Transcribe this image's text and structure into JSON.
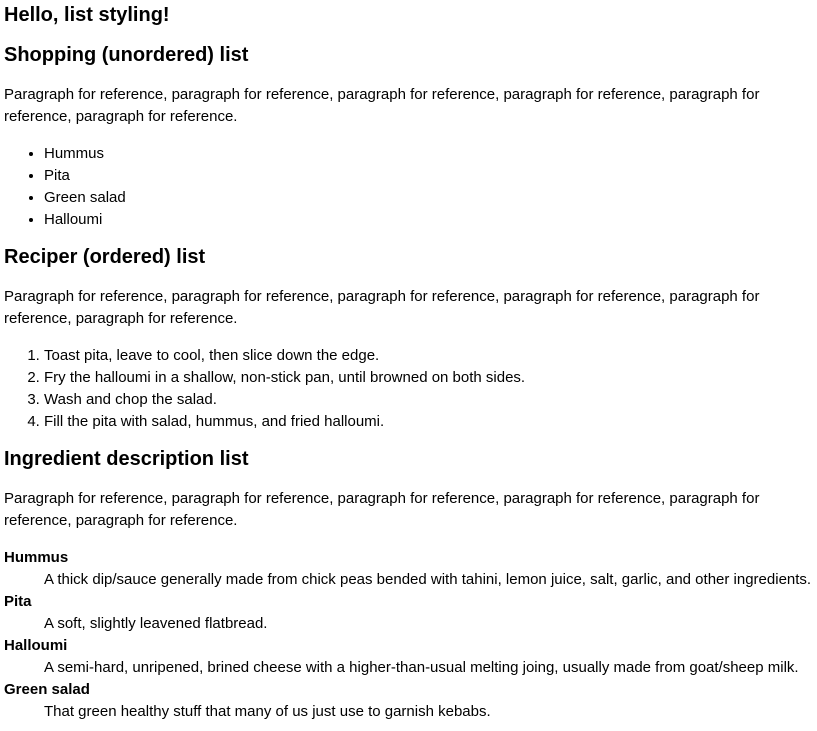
{
  "page_title": "Hello, list styling!",
  "shopping": {
    "heading": "Shopping (unordered) list",
    "paragraph": "Paragraph for reference, paragraph for reference, paragraph for reference, paragraph for reference, paragraph for reference, paragraph for reference.",
    "items": [
      "Hummus",
      "Pita",
      "Green salad",
      "Halloumi"
    ]
  },
  "recipe": {
    "heading": "Reciper (ordered) list",
    "paragraph": "Paragraph for reference, paragraph for reference, paragraph for reference, paragraph for reference, paragraph for reference, paragraph for reference.",
    "steps": [
      "Toast pita, leave to cool, then slice down the edge.",
      "Fry the halloumi in a shallow, non-stick pan, until browned on both sides.",
      "Wash and chop the salad.",
      "Fill the pita with salad, hummus, and fried halloumi."
    ]
  },
  "ingredients": {
    "heading": "Ingredient description list",
    "paragraph": "Paragraph for reference, paragraph for reference, paragraph for reference, paragraph for reference, paragraph for reference, paragraph for reference.",
    "entries": [
      {
        "term": "Hummus",
        "description": "A thick dip/sauce generally made from chick peas bended with tahini, lemon juice, salt, garlic, and other ingredients."
      },
      {
        "term": "Pita",
        "description": "A soft, slightly leavened flatbread."
      },
      {
        "term": "Halloumi",
        "description": "A semi-hard, unripened, brined cheese with a higher-than-usual melting joing, usually made from goat/sheep milk."
      },
      {
        "term": "Green salad",
        "description": "That green healthy stuff that many of us just use to garnish kebabs."
      }
    ]
  }
}
